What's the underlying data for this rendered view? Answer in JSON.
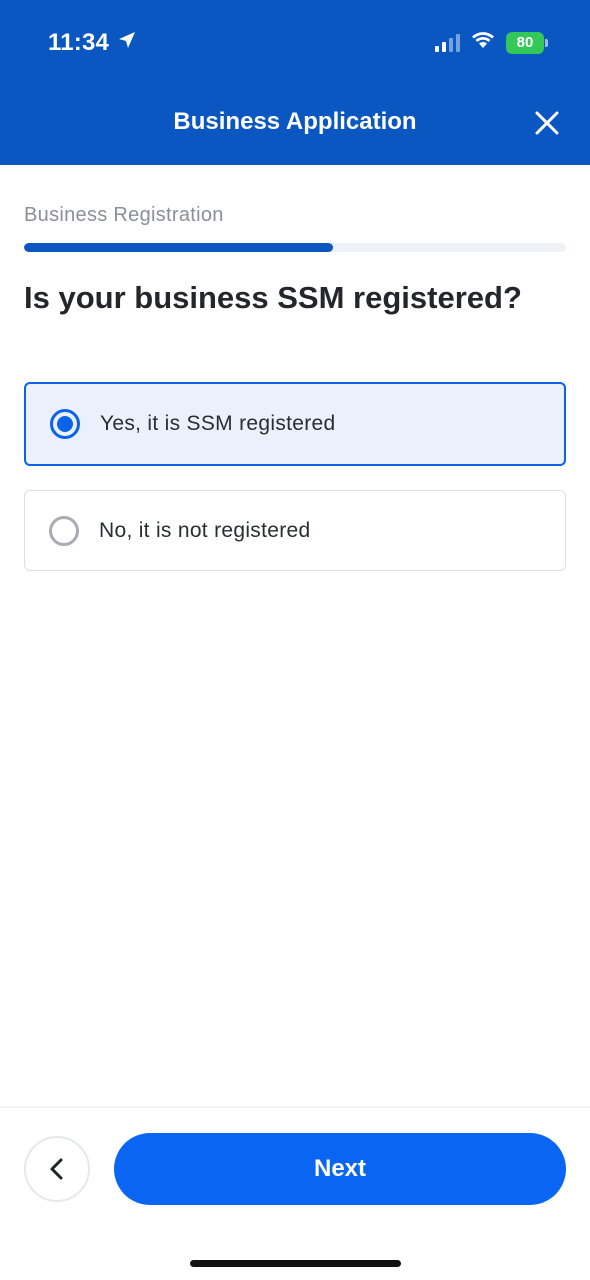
{
  "status_bar": {
    "time": "11:34",
    "battery": "80",
    "icons": [
      "location-arrow-icon",
      "cellular-signal-icon",
      "wifi-icon",
      "battery-icon"
    ]
  },
  "header": {
    "title": "Business Application",
    "close_icon": "close-icon",
    "background_color": "#0a57c2"
  },
  "step": {
    "label": "Business Registration",
    "progress_fraction": 0.57
  },
  "question": "Is your business SSM registered?",
  "options": [
    {
      "label": "Yes, it is SSM registered",
      "selected": true
    },
    {
      "label": "No, it is not registered",
      "selected": false
    }
  ],
  "footer": {
    "back_icon": "chevron-left-icon",
    "next_label": "Next",
    "accent_color": "#0a66f2"
  }
}
